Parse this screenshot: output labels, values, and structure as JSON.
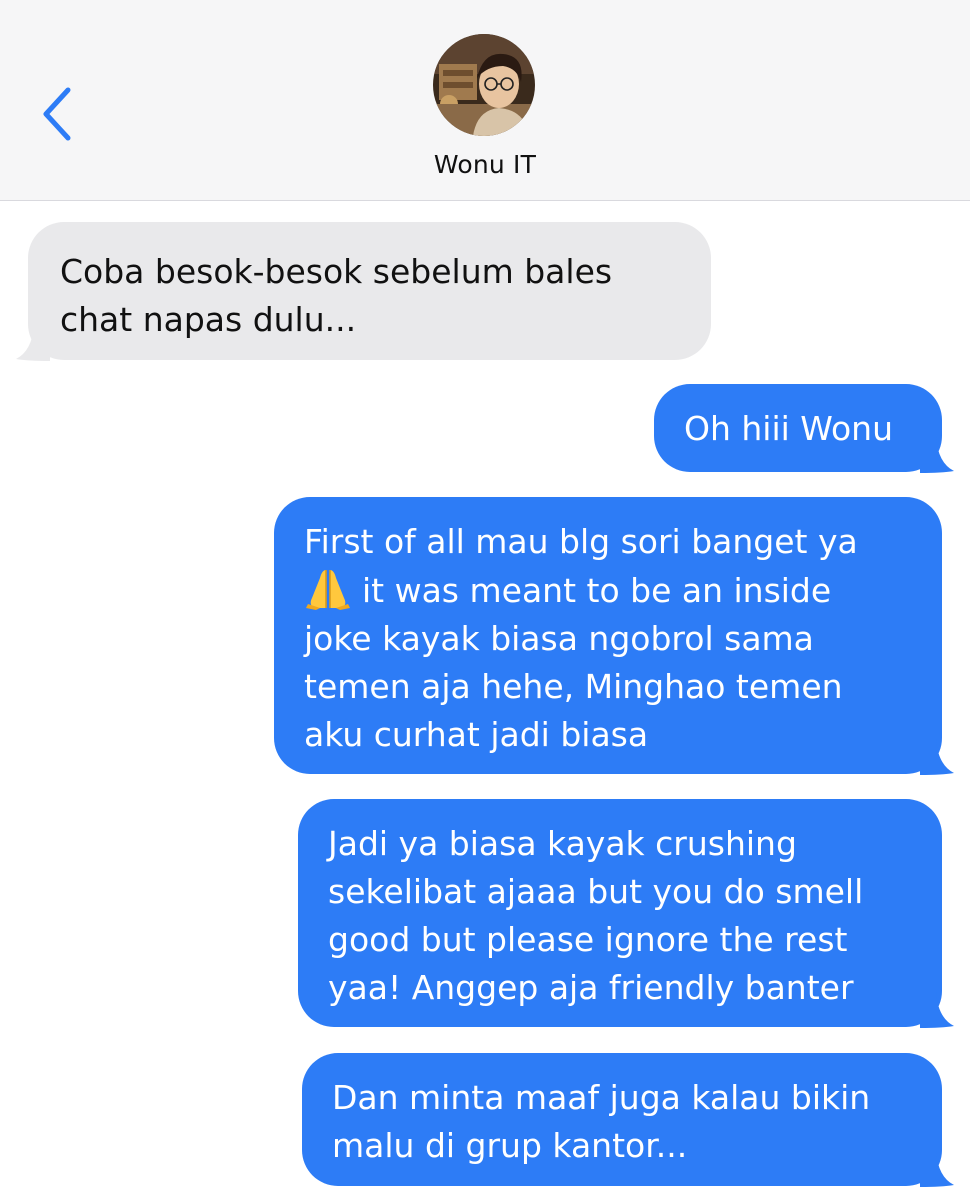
{
  "header": {
    "contact_name": "Wonu IT",
    "back_icon": "chevron-left-icon",
    "accent_color": "#2d7cf6"
  },
  "messages": [
    {
      "direction": "incoming",
      "lines": [
        "Coba besok-besok sebelum bales",
        "chat napas dulu..."
      ]
    },
    {
      "direction": "outgoing",
      "lines": [
        "Oh hiii Wonu"
      ]
    },
    {
      "direction": "outgoing",
      "lines": [
        "First of all mau blg sori banget ya",
        "it was meant to be an inside",
        "joke kayak biasa ngobrol sama",
        "temen aja hehe, Minghao temen",
        "aku curhat jadi biasa"
      ],
      "emoji": "folded-hands-emoji"
    },
    {
      "direction": "outgoing",
      "lines": [
        "Jadi ya biasa kayak crushing",
        "sekelibat ajaaa but you do smell",
        "good but please ignore the rest",
        "yaa! Anggep aja friendly banter"
      ]
    },
    {
      "direction": "outgoing",
      "lines": [
        "Dan minta maaf juga kalau bikin",
        "malu di grup kantor..."
      ]
    }
  ],
  "colors": {
    "incoming_bubble": "#e9e9eb",
    "outgoing_bubble": "#2d7cf6",
    "header_background": "#f6f6f7"
  }
}
